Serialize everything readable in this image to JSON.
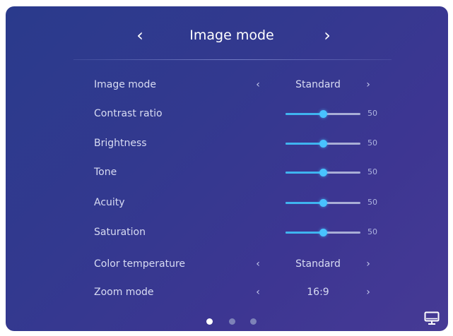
{
  "header": {
    "title": "Image mode",
    "prev_arrow": "‹",
    "next_arrow": "›"
  },
  "settings": [
    {
      "label": "Image mode",
      "type": "selector",
      "value": "Standard"
    },
    {
      "label": "Contrast ratio",
      "type": "slider",
      "value": 50,
      "max": 100
    },
    {
      "label": "Brightness",
      "type": "slider",
      "value": 50,
      "max": 100
    },
    {
      "label": "Tone",
      "type": "slider",
      "value": 50,
      "max": 100
    },
    {
      "label": "Acuity",
      "type": "slider",
      "value": 50,
      "max": 100
    },
    {
      "label": "Saturation",
      "type": "slider",
      "value": 50,
      "max": 100
    },
    {
      "label": "Color temperature",
      "type": "selector",
      "value": "Standard"
    },
    {
      "label": "Zoom mode",
      "type": "selector",
      "value": "16:9"
    }
  ],
  "selector_arrows": {
    "left": "‹",
    "right": "›"
  },
  "pagination": {
    "pages": 3,
    "active_index": 0
  },
  "icons": {
    "corner": "monitor-icon"
  },
  "colors": {
    "accent": "#48c3ff",
    "panel_start": "#2a3a8c",
    "panel_end": "#463a95"
  }
}
